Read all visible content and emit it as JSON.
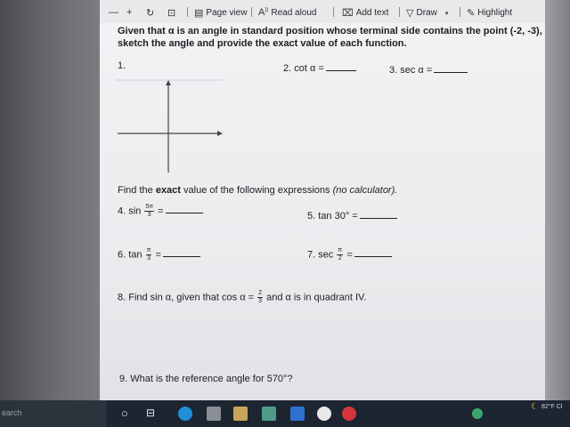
{
  "toolbar": {
    "page_view": "Page view",
    "read_aloud": "Read aloud",
    "add_text": "Add text",
    "draw": "Draw",
    "highlight": "Highlight"
  },
  "problem_header": {
    "line1": "Given that α is an angle in standard position whose terminal side contains the point (-2, -3),",
    "line2": "sketch the angle and provide the exact value of each function."
  },
  "q1": "1.",
  "q2": "2. cot α =",
  "q3": "3. sec α =",
  "section2": {
    "prefix": "Find the ",
    "bold": "exact",
    "middle": " value of the following expressions ",
    "italic": "(no calculator)."
  },
  "q4": {
    "label": "4. sin",
    "num": "5π",
    "den": "3",
    "eq": "="
  },
  "q5": "5. tan 30° =",
  "q6": {
    "label": "6. tan",
    "num": "π",
    "den": "3",
    "eq": "="
  },
  "q7": {
    "label": "7. sec",
    "num": "π",
    "den": "2",
    "eq": "="
  },
  "q8": {
    "pre": "8. Find sin α, given that cos α =",
    "num": "2",
    "den": "3",
    "post": "and α is in quadrant IV."
  },
  "q9": "9. What is the reference angle for 570°?",
  "taskbar": {
    "search": "earch",
    "weather": "82°F Cl"
  }
}
